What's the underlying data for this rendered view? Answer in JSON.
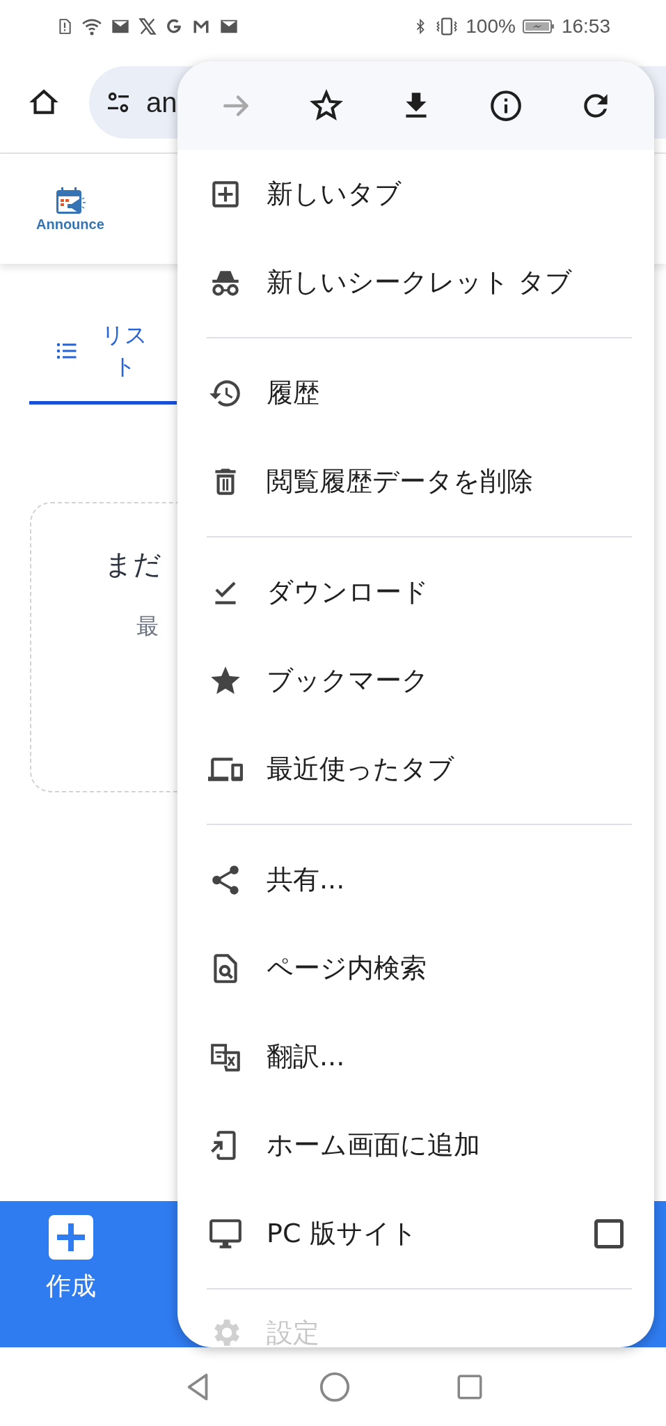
{
  "status_bar": {
    "battery": "100%",
    "time": "16:53"
  },
  "toolbar": {
    "url": "an"
  },
  "app_header": {
    "logo_text": "Announce"
  },
  "tabs": [
    {
      "label": "リスト",
      "selected": true
    }
  ],
  "empty_card": {
    "title": "まだ",
    "subtitle": "最"
  },
  "bottom_bar": {
    "create_label": "作成"
  },
  "menu": {
    "actions": [
      {
        "kind": "forward",
        "disabled": true
      },
      {
        "kind": "bookmark",
        "disabled": false
      },
      {
        "kind": "download",
        "disabled": false
      },
      {
        "kind": "info",
        "disabled": false
      },
      {
        "kind": "reload",
        "disabled": false
      }
    ],
    "sections": [
      [
        {
          "kind": "new-tab",
          "label": "新しいタブ"
        },
        {
          "kind": "incognito",
          "label": "新しいシークレット タブ"
        }
      ],
      [
        {
          "kind": "history",
          "label": "履歴"
        },
        {
          "kind": "trash",
          "label": "閲覧履歴データを削除"
        }
      ],
      [
        {
          "kind": "downloads",
          "label": "ダウンロード"
        },
        {
          "kind": "star",
          "label": "ブックマーク"
        },
        {
          "kind": "devices",
          "label": "最近使ったタブ"
        }
      ],
      [
        {
          "kind": "share",
          "label": "共有..."
        },
        {
          "kind": "find",
          "label": "ページ内検索"
        },
        {
          "kind": "translate",
          "label": "翻訳..."
        },
        {
          "kind": "add-home",
          "label": "ホーム画面に追加"
        },
        {
          "kind": "desktop",
          "label": "PC 版サイト",
          "checkbox": {
            "checked": false
          }
        }
      ],
      [
        {
          "kind": "settings",
          "label": "設定",
          "faded": true
        }
      ]
    ]
  }
}
